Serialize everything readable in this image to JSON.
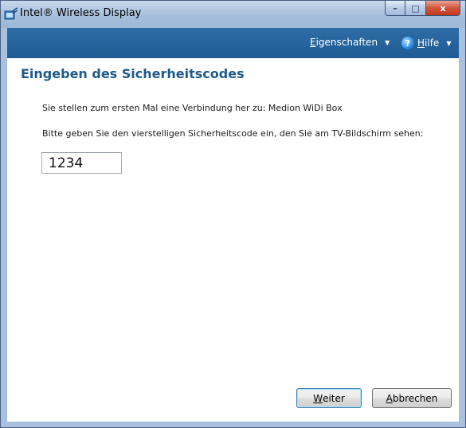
{
  "window": {
    "title": "Intel® Wireless Display",
    "min_glyph": "–",
    "max_glyph": "□",
    "close_glyph": "x"
  },
  "toolbar": {
    "properties": {
      "mnemonic": "E",
      "rest": "igenschaften",
      "caret": "▼"
    },
    "help": {
      "icon_glyph": "?",
      "mnemonic": "H",
      "rest": "ilfe",
      "caret": "▼"
    }
  },
  "page": {
    "title": "Eingeben des Sicherheitscodes",
    "connection_text": "Sie stellen zum ersten Mal eine Verbindung her zu: Medion WiDi Box",
    "instruction_text": "Bitte geben Sie den vierstelligen Sicherheitscode ein, den Sie am TV-Bildschirm sehen:",
    "code_value": "1234"
  },
  "buttons": {
    "next": {
      "mnemonic": "W",
      "rest": "eiter"
    },
    "cancel": {
      "mnemonic": "A",
      "rest": "bbrechen"
    }
  },
  "colors": {
    "accent": "#1e5a8b",
    "toolbar": "#2465a0",
    "frame": "#a9c1dc"
  },
  "icons": {
    "app": "wireless-display-icon",
    "help": "help-icon"
  }
}
